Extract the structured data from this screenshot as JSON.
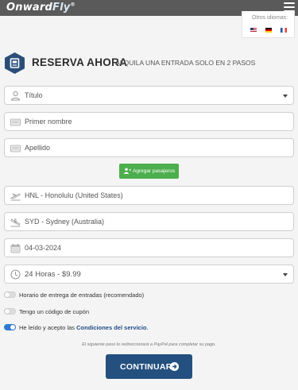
{
  "brand": {
    "logo_prefix": "Onward",
    "logo_suffix": "Fly",
    "trademark": "®"
  },
  "languages": {
    "label": "Otros idiomas:",
    "items": [
      {
        "code": "en",
        "icon": "us-flag-icon"
      },
      {
        "code": "de",
        "icon": "germany-flag-icon"
      },
      {
        "code": "fr",
        "icon": "france-flag-icon"
      }
    ]
  },
  "header": {
    "title": "RESERVA AHORA",
    "subtitle": "/ ALQUILA UNA ENTRADA SOLO EN 2 PASOS",
    "icon": "ticket-icon"
  },
  "form": {
    "title_select": {
      "value": "Título",
      "icon": "user-icon"
    },
    "first_name": {
      "placeholder": "Primer nombre",
      "icon": "id-card-icon"
    },
    "last_name": {
      "placeholder": "Apellido",
      "icon": "id-card-icon"
    },
    "add_passengers": {
      "label": "Agregar pasajeros",
      "icon": "add-user-icon"
    },
    "origin": {
      "value": "HNL - Honolulu (United States)",
      "icon": "plane-departure-icon"
    },
    "destination": {
      "value": "SYD - Sydney (Australia)",
      "icon": "plane-arrival-icon"
    },
    "date": {
      "value": "04-03-2024",
      "icon": "calendar-icon"
    },
    "duration": {
      "value": "24 Horas - $9.99",
      "icon": "clock-icon"
    }
  },
  "options": {
    "delivery_time": {
      "label": "Horario de entrega de entradas (recomendado)",
      "on": false
    },
    "coupon": {
      "label": "Tengo un código de cupón",
      "on": false
    },
    "terms": {
      "label_prefix": "He leído y acepto las ",
      "link": "Condiciones del servicio",
      "suffix": ".",
      "on": true
    }
  },
  "redirect_note": "El siguiente paso lo redireccionará a PayPal para completar su pago.",
  "continue_button": {
    "label": "CONTINUAR",
    "icon": "circle-arrow-right-icon"
  },
  "colors": {
    "topbar": "#5a5a5a",
    "accent": "#24507f",
    "success": "#4cae4c",
    "toggle_on": "#2f7ad6",
    "brand_icon": "#2b4e79"
  }
}
